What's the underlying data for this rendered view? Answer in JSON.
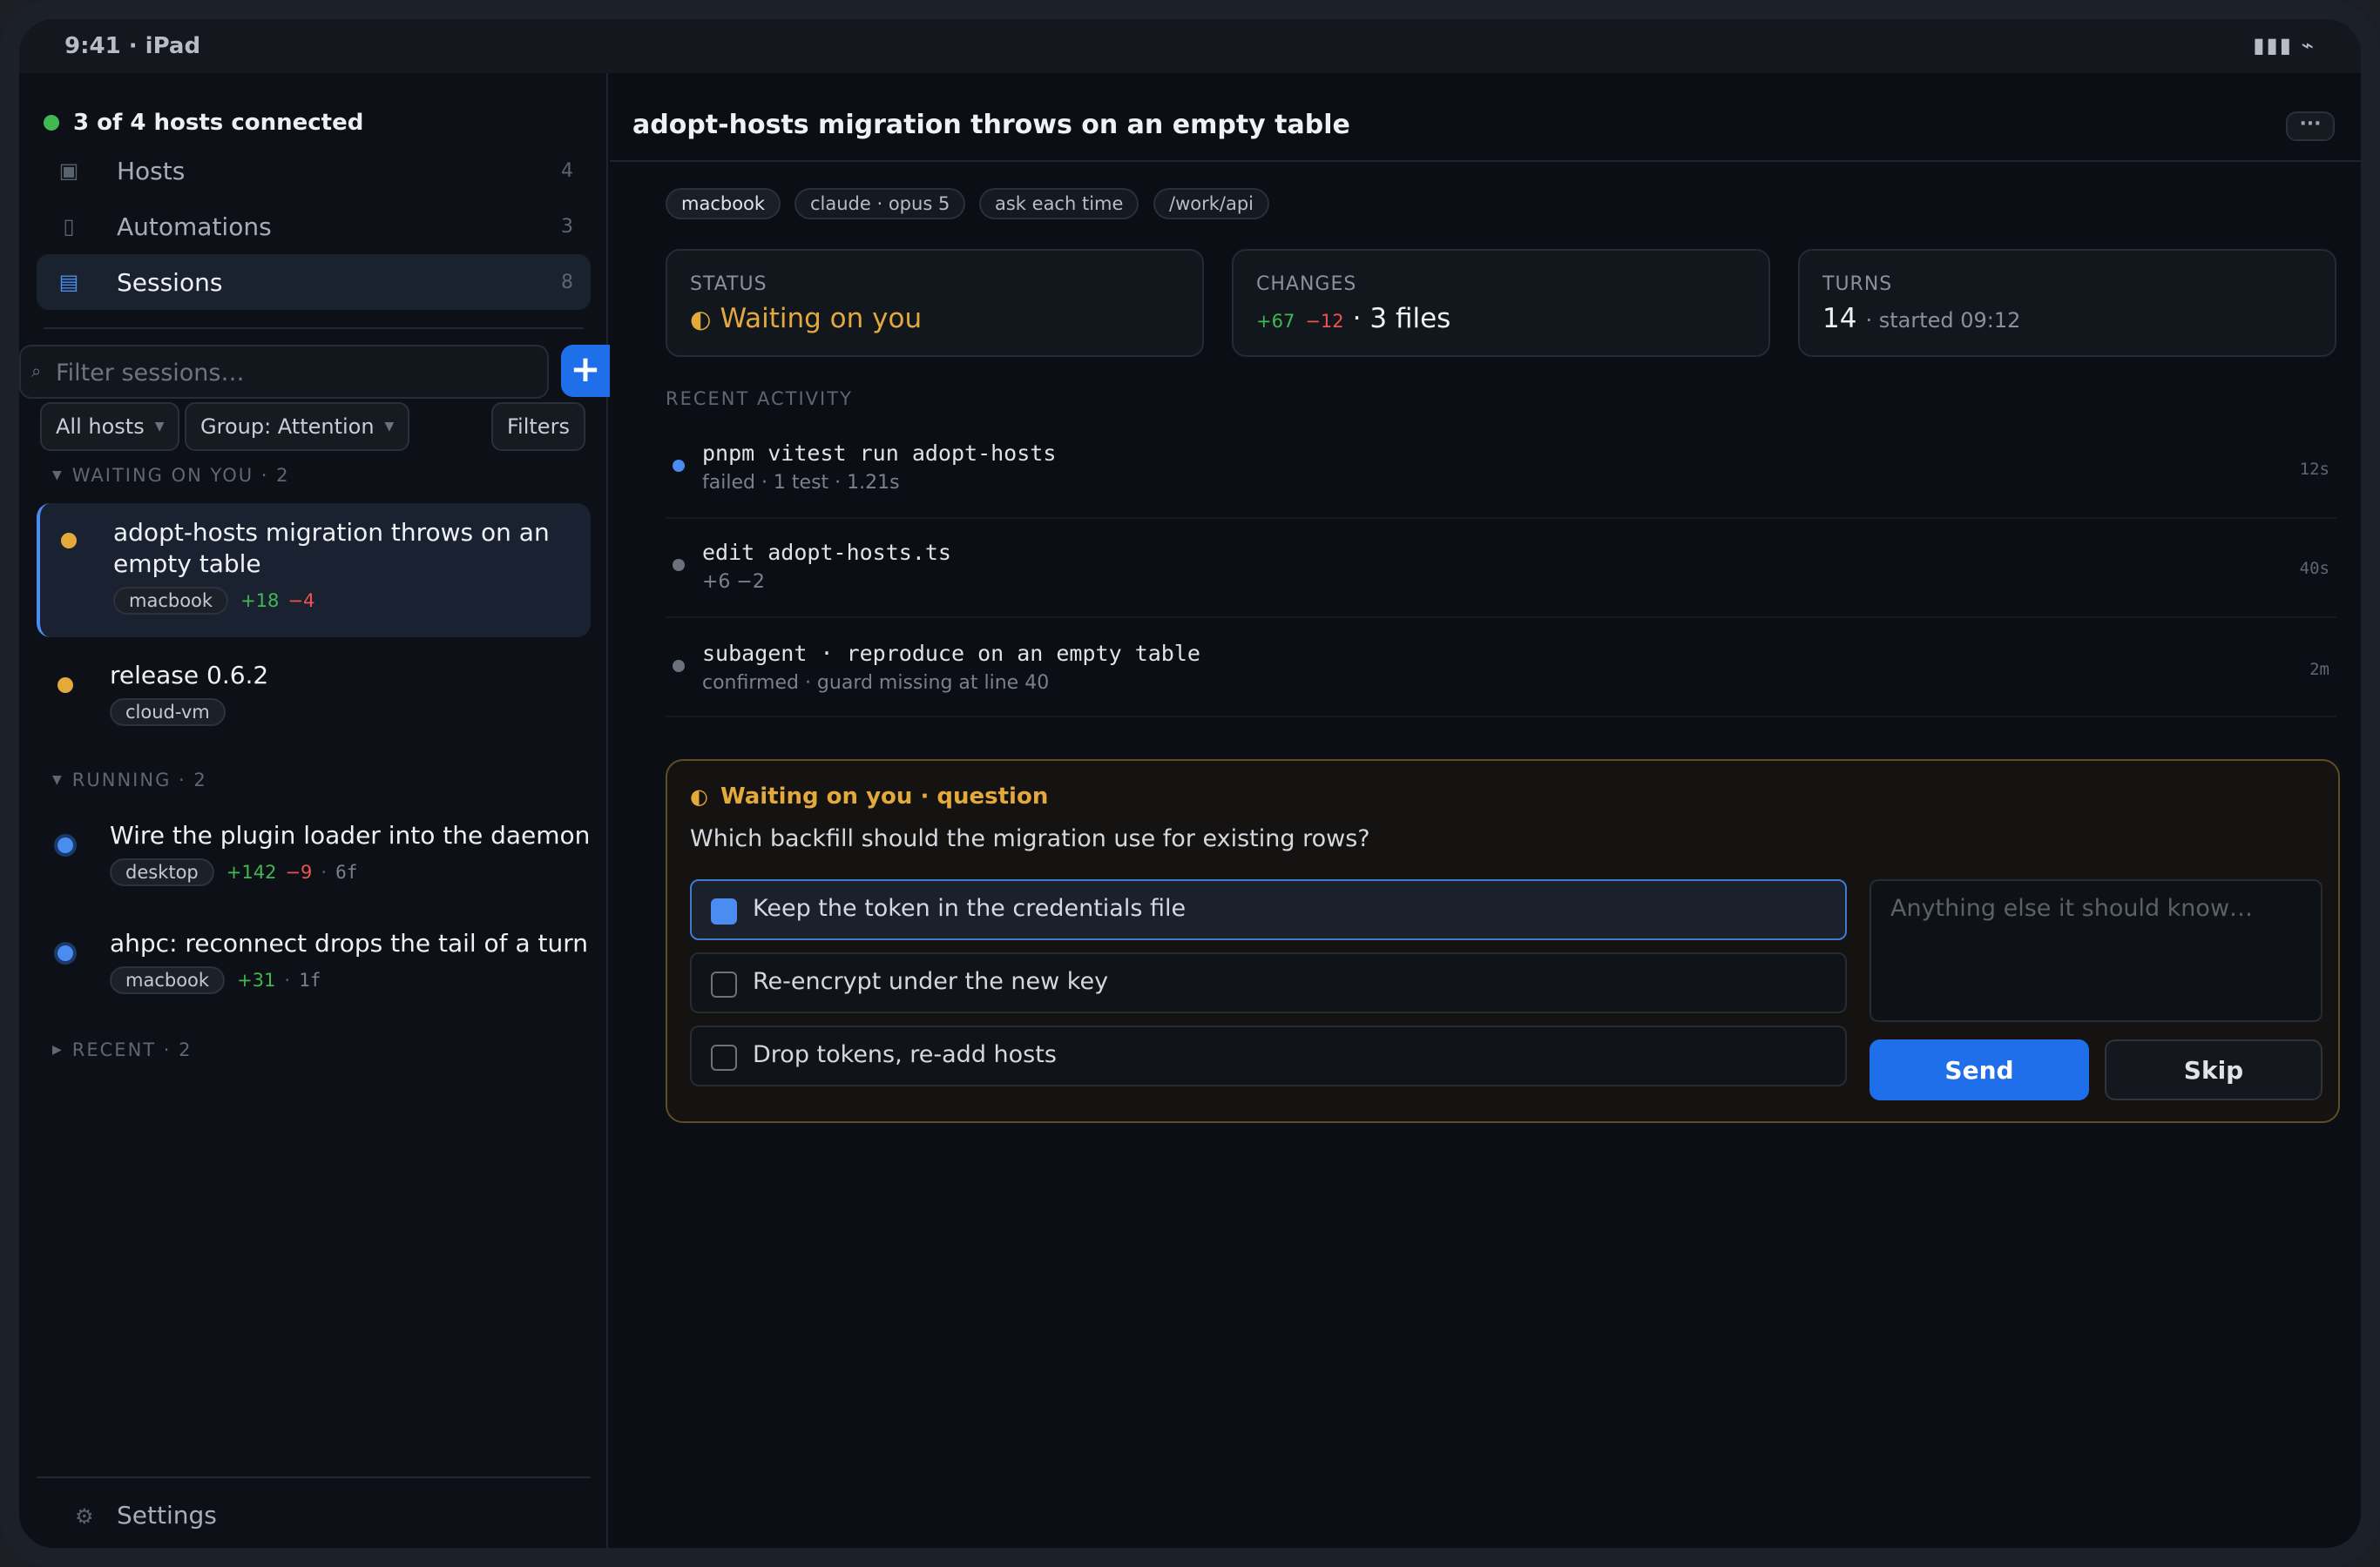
{
  "status_bar": {
    "time": "9:41 · iPad",
    "icons": "▮▮▮ ⌁"
  },
  "sidebar": {
    "connection": "3 of 4 hosts connected",
    "nav": [
      {
        "label": "Hosts",
        "count": "4",
        "icon": "server-icon"
      },
      {
        "label": "Automations",
        "count": "3",
        "icon": "automation-icon"
      },
      {
        "label": "Sessions",
        "count": "8",
        "icon": "sessions-icon"
      }
    ],
    "search": {
      "placeholder": "Filter sessions…",
      "add_label": "+"
    },
    "filters": {
      "hosts": "All hosts",
      "group": "Group: Attention",
      "filters": "Filters"
    },
    "groups": {
      "waiting": "WAITING ON YOU · 2",
      "running": "RUNNING · 2",
      "recent": "RECENT · 2"
    },
    "sessions": [
      {
        "title_line1": "adopt-hosts migration throws on an",
        "title_line2": "empty table",
        "host": "macbook",
        "plus": "+18",
        "minus": "−4",
        "status": "waiting"
      },
      {
        "title": "release 0.6.2",
        "host": "cloud-vm",
        "status": "waiting"
      },
      {
        "title": "Wire the plugin loader into the daemon",
        "host": "desktop",
        "plus": "+142",
        "minus": "−9",
        "sep": "·",
        "files": "6f",
        "status": "running"
      },
      {
        "title": "ahpc: reconnect drops the tail of a turn",
        "host": "macbook",
        "plus": "+31",
        "sep": "·",
        "files": "1f",
        "status": "running"
      }
    ],
    "settings": "Settings"
  },
  "main": {
    "title": "adopt-hosts migration throws on an empty table",
    "more": "···",
    "chips": [
      "macbook",
      "claude · opus 5",
      "ask each time",
      "/work/api"
    ],
    "cards": {
      "status": {
        "label": "STATUS",
        "icon": "◐",
        "value": "Waiting on you"
      },
      "changes": {
        "label": "CHANGES",
        "plus": "+67",
        "minus": "−12",
        "files": "· 3 files"
      },
      "turns": {
        "label": "TURNS",
        "value": "14",
        "started": "· started 09:12"
      }
    },
    "recent_label": "RECENT ACTIVITY",
    "activity": [
      {
        "title": "pnpm vitest run adopt-hosts",
        "sub": "failed · 1 test · 1.21s",
        "time": "12s",
        "dot_color": "#4a8cf0"
      },
      {
        "title": "edit adopt-hosts.ts",
        "sub": "+6 −2",
        "time": "40s",
        "dot_color": "#6b727d"
      },
      {
        "title": "subagent · reproduce on an empty table",
        "sub": "confirmed · guard missing at line 40",
        "time": "2m",
        "dot_color": "#6b727d"
      }
    ],
    "question": {
      "icon": "◐",
      "title": "Waiting on you · question",
      "text": "Which backfill should the migration use for existing rows?",
      "options": [
        "Keep the token in the credentials file",
        "Re-encrypt under the new key",
        "Drop tokens, re-add hosts"
      ],
      "note_placeholder": "Anything else it should know…",
      "send": "Send",
      "skip": "Skip"
    }
  },
  "colors": {
    "accent": "#1f6feb",
    "waiting": "#e3a93b",
    "added": "#3fb950",
    "removed": "#f0524f",
    "connected": "#3fb950"
  }
}
